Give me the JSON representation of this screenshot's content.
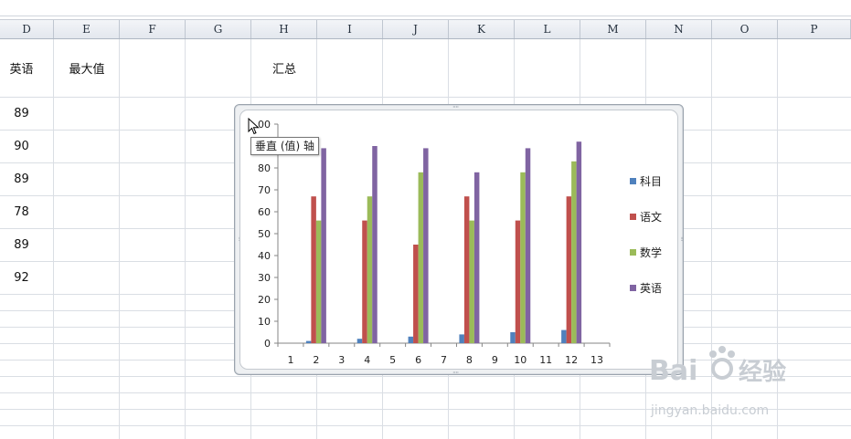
{
  "columns": [
    "D",
    "E",
    "F",
    "G",
    "H",
    "I",
    "J",
    "K",
    "L",
    "M",
    "N",
    "O",
    "P"
  ],
  "header_cells": {
    "d": "英语",
    "e": "最大值",
    "h": "汇总"
  },
  "english_scores": [
    "89",
    "90",
    "89",
    "78",
    "89",
    "92"
  ],
  "tooltip": "垂直 (值) 轴",
  "watermark": {
    "brand": "Bai",
    "brand_cn": "经验",
    "url": "jingyan.baidu.com"
  },
  "chart_data": {
    "type": "bar",
    "categories": [
      "1",
      "2",
      "3",
      "4",
      "5",
      "6",
      "7",
      "8",
      "9",
      "10",
      "11",
      "12",
      "13"
    ],
    "ylim": [
      0,
      100
    ],
    "yticks": [
      "0",
      "10",
      "20",
      "30",
      "40",
      "50",
      "60",
      "70",
      "80",
      "90",
      "00"
    ],
    "series": [
      {
        "name": "科目",
        "color": "#4f81bd",
        "values": [
          null,
          1,
          null,
          2,
          null,
          3,
          null,
          4,
          null,
          5,
          null,
          6,
          null
        ]
      },
      {
        "name": "语文",
        "color": "#c0504d",
        "values": [
          null,
          67,
          null,
          56,
          null,
          45,
          null,
          67,
          null,
          56,
          null,
          67,
          null
        ]
      },
      {
        "name": "数学",
        "color": "#9bbb59",
        "values": [
          null,
          56,
          null,
          67,
          null,
          78,
          null,
          56,
          null,
          78,
          null,
          83,
          null
        ]
      },
      {
        "name": "英语",
        "color": "#8064a2",
        "values": [
          null,
          89,
          null,
          90,
          null,
          89,
          null,
          78,
          null,
          89,
          null,
          92,
          null
        ]
      }
    ],
    "grid": false,
    "legend": "right"
  }
}
